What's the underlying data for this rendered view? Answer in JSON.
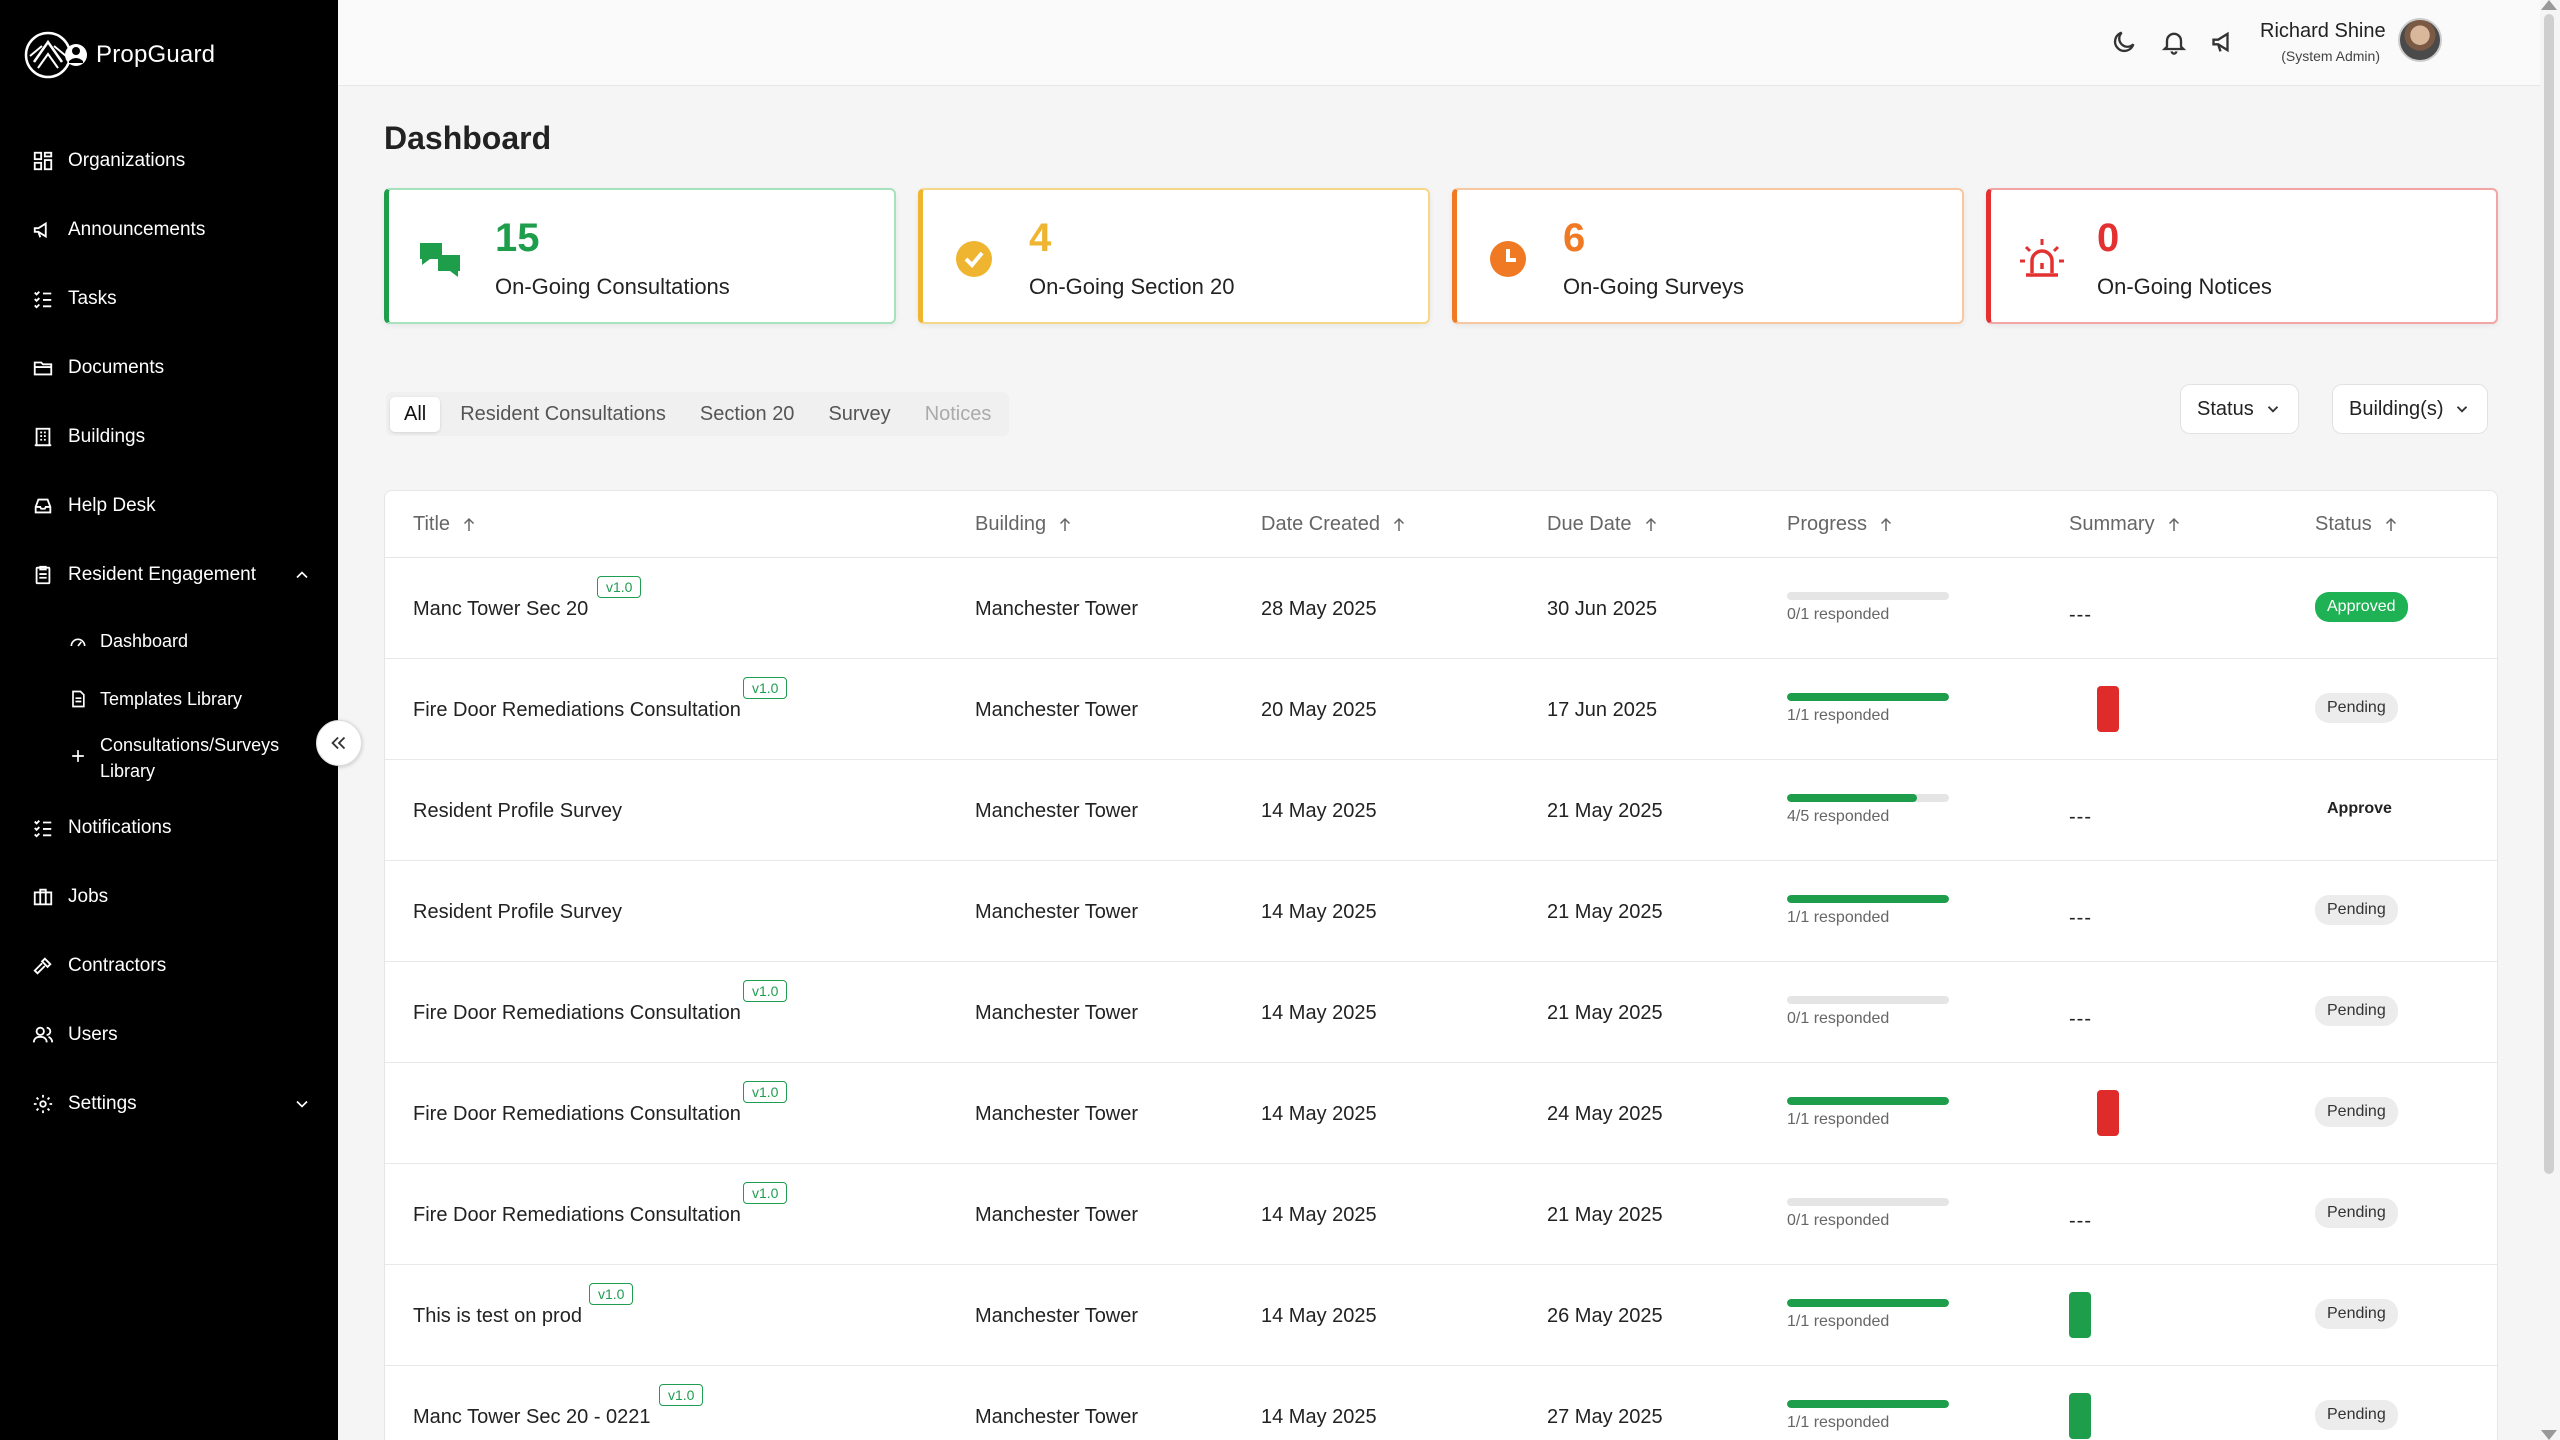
{
  "brand": {
    "name": "PropGuard"
  },
  "sidebar": {
    "items": [
      {
        "label": "Organizations",
        "icon": "grid-icon"
      },
      {
        "label": "Announcements",
        "icon": "megaphone-icon"
      },
      {
        "label": "Tasks",
        "icon": "checklist-icon"
      },
      {
        "label": "Documents",
        "icon": "folder-icon"
      },
      {
        "label": "Buildings",
        "icon": "building-icon"
      },
      {
        "label": "Help Desk",
        "icon": "inbox-icon"
      },
      {
        "label": "Resident Engagement",
        "icon": "clipboard-icon"
      },
      {
        "label": "Notifications",
        "icon": "checklist-icon"
      },
      {
        "label": "Jobs",
        "icon": "briefcase-icon"
      },
      {
        "label": "Contractors",
        "icon": "hammer-icon"
      },
      {
        "label": "Users",
        "icon": "users-icon"
      },
      {
        "label": "Settings",
        "icon": "gear-icon"
      }
    ],
    "sub_items": [
      {
        "label": "Dashboard",
        "icon": "gauge-icon"
      },
      {
        "label": "Templates Library",
        "icon": "document-icon"
      },
      {
        "label": "Consultations/Surveys Library",
        "icon": "plus-icon"
      }
    ]
  },
  "header": {
    "user_name": "Richard Shine",
    "user_role": "(System Admin)"
  },
  "page": {
    "title": "Dashboard"
  },
  "stats": [
    {
      "value": "15",
      "label": "On-Going Consultations",
      "color": "#1e9d4b"
    },
    {
      "value": "4",
      "label": "On-Going Section 20",
      "color": "#f0b530"
    },
    {
      "value": "6",
      "label": "On-Going Surveys",
      "color": "#f07a24"
    },
    {
      "value": "0",
      "label": "On-Going Notices",
      "color": "#e33131"
    }
  ],
  "tabs": [
    "All",
    "Resident Consultations",
    "Section 20",
    "Survey",
    "Notices"
  ],
  "filters": {
    "status": "Status",
    "buildings": "Building(s)"
  },
  "table": {
    "columns": [
      "Title",
      "Building",
      "Date Created",
      "Due Date",
      "Progress",
      "Summary",
      "Status"
    ],
    "rows": [
      {
        "title": "Manc Tower Sec 20",
        "version": "v1.0",
        "building": "Manchester Tower",
        "created": "28 May 2025",
        "due": "30 Jun 2025",
        "progress": 0,
        "responded": "0/1 responded",
        "summary": "---",
        "status": "Approved"
      },
      {
        "title": "Fire Door Remediations Consultation",
        "version": "v1.0",
        "building": "Manchester Tower",
        "created": "20 May 2025",
        "due": "17 Jun 2025",
        "progress": 1,
        "responded": "1/1 responded",
        "summary": "red",
        "status": "Pending"
      },
      {
        "title": "Resident Profile Survey",
        "version": "",
        "building": "Manchester Tower",
        "created": "14 May 2025",
        "due": "21 May 2025",
        "progress": 0.8,
        "responded": "4/5 responded",
        "summary": "---",
        "status": "Approve"
      },
      {
        "title": "Resident Profile Survey",
        "version": "",
        "building": "Manchester Tower",
        "created": "14 May 2025",
        "due": "21 May 2025",
        "progress": 1,
        "responded": "1/1 responded",
        "summary": "---",
        "status": "Pending"
      },
      {
        "title": "Fire Door Remediations Consultation",
        "version": "v1.0",
        "building": "Manchester Tower",
        "created": "14 May 2025",
        "due": "21 May 2025",
        "progress": 0,
        "responded": "0/1 responded",
        "summary": "---",
        "status": "Pending"
      },
      {
        "title": "Fire Door Remediations Consultation",
        "version": "v1.0",
        "building": "Manchester Tower",
        "created": "14 May 2025",
        "due": "24 May 2025",
        "progress": 1,
        "responded": "1/1 responded",
        "summary": "red",
        "status": "Pending"
      },
      {
        "title": "Fire Door Remediations Consultation",
        "version": "v1.0",
        "building": "Manchester Tower",
        "created": "14 May 2025",
        "due": "21 May 2025",
        "progress": 0,
        "responded": "0/1 responded",
        "summary": "---",
        "status": "Pending"
      },
      {
        "title": "This is test on prod",
        "version": "v1.0",
        "building": "Manchester Tower",
        "created": "14 May 2025",
        "due": "26 May 2025",
        "progress": 1,
        "responded": "1/1 responded",
        "summary": "green",
        "status": "Pending"
      },
      {
        "title": "Manc Tower Sec 20 - 0221",
        "version": "v1.0",
        "building": "Manchester Tower",
        "created": "14 May 2025",
        "due": "27 May 2025",
        "progress": 1,
        "responded": "1/1 responded",
        "summary": "green",
        "status": "Pending"
      }
    ]
  },
  "colors": {
    "summary_red": "#e02b2b",
    "summary_green": "#1e9d4b"
  }
}
